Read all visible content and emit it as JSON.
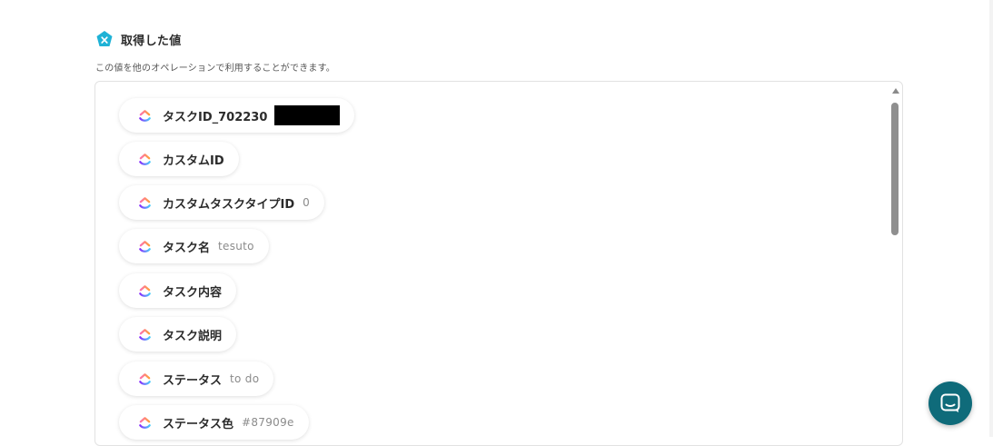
{
  "section": {
    "title": "取得した値",
    "description": "この値を他のオペレーションで利用することができます。"
  },
  "fields": [
    {
      "label": "タスクID_702230",
      "value": "",
      "redacted": true
    },
    {
      "label": "カスタムID",
      "value": ""
    },
    {
      "label": "カスタムタスクタイプID",
      "value": "0"
    },
    {
      "label": "タスク名",
      "value": "tesuto"
    },
    {
      "label": "タスク内容",
      "value": ""
    },
    {
      "label": "タスク説明",
      "value": ""
    },
    {
      "label": "ステータス",
      "value": "to do"
    },
    {
      "label": "ステータス色",
      "value": "#87909e"
    }
  ],
  "icons": {
    "header": "yoom-x-icon",
    "field": "clickup-icon",
    "chat": "chat-icon"
  },
  "colors": {
    "header_icon": "#1fb2d6",
    "chat_button": "#0f6b7a",
    "clickup_pink": "#fd71af",
    "clickup_purple": "#7b68ee",
    "clickup_blue": "#49ccf9"
  }
}
